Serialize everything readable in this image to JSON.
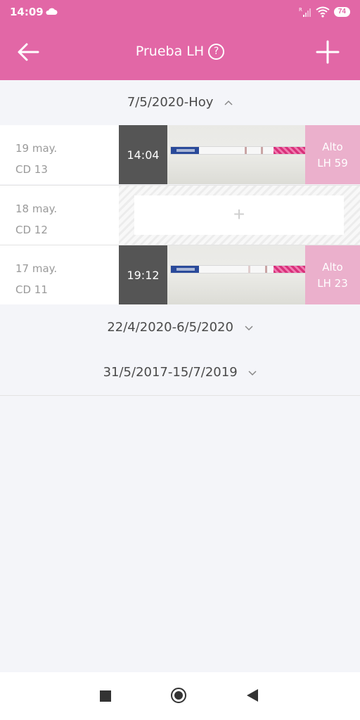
{
  "status_bar": {
    "time": "14:09",
    "battery": "74"
  },
  "header": {
    "title": "Prueba LH",
    "help_symbol": "?"
  },
  "sections": [
    {
      "label": "7/5/2020-Hoy",
      "expanded": true
    },
    {
      "label": "22/4/2020-6/5/2020",
      "expanded": false
    },
    {
      "label": "31/5/2017-15/7/2019",
      "expanded": false
    }
  ],
  "entries": [
    {
      "date": "19 may.",
      "cycle_day": "CD 13",
      "time": "14:04",
      "result_label": "Alto",
      "lh_value": "LH 59"
    },
    {
      "date": "18 may.",
      "cycle_day": "CD 12",
      "add_symbol": "+"
    },
    {
      "date": "17 may.",
      "cycle_day": "CD 11",
      "time": "19:12",
      "result_label": "Alto",
      "lh_value": "LH 23"
    }
  ],
  "colors": {
    "brand": "#e267a6",
    "result_bg": "#ebb0cc",
    "background": "#f4f5f9"
  },
  "icons": [
    "cloud-icon",
    "signal-icon",
    "wifi-icon",
    "battery-icon",
    "back-arrow-icon",
    "help-icon",
    "add-icon",
    "chevron-up-icon",
    "chevron-down-icon",
    "nav-recents-icon",
    "nav-home-icon",
    "nav-back-icon"
  ]
}
